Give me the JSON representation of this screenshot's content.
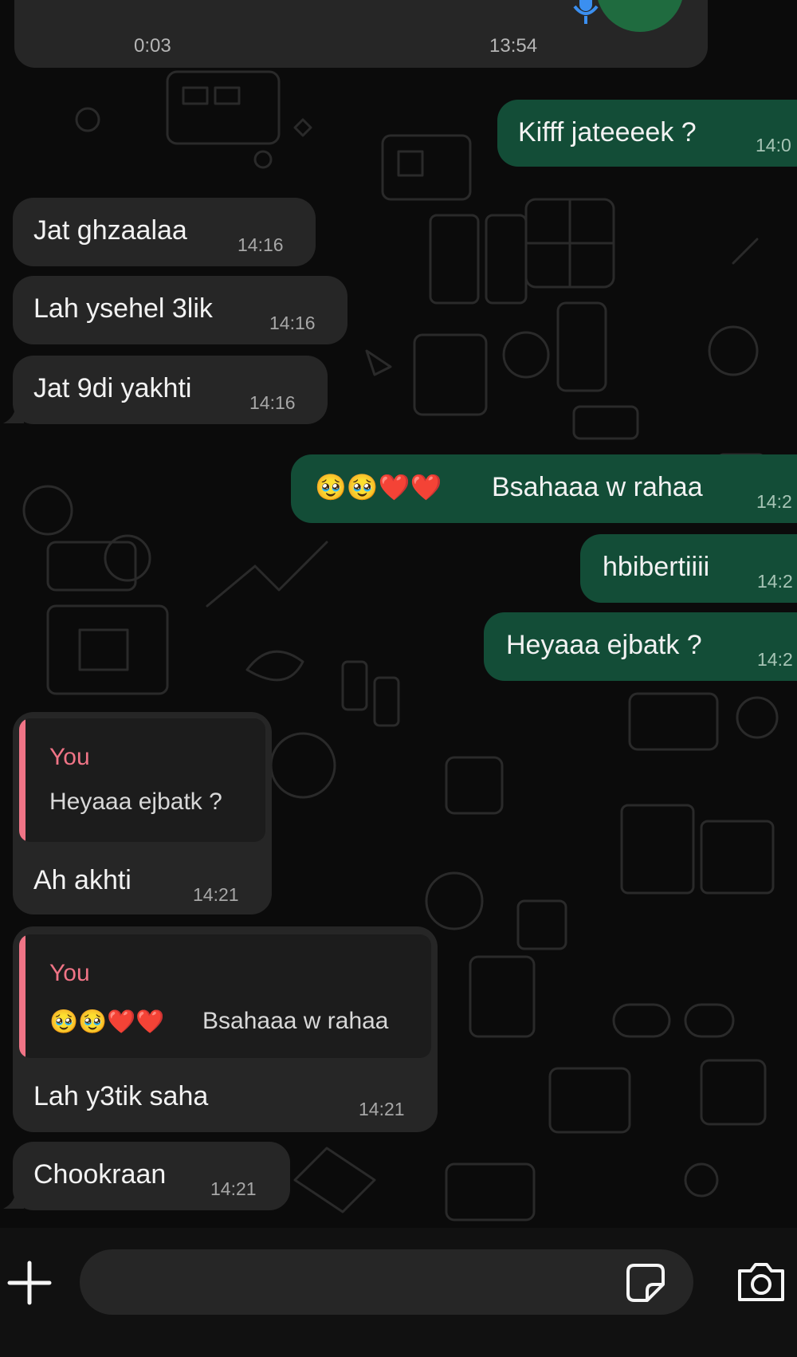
{
  "voice_message": {
    "duration": "0:03",
    "time": "13:54"
  },
  "messages": [
    {
      "dir": "out",
      "text": "Kifff jateeeek ?",
      "time": "14:0"
    },
    {
      "dir": "in",
      "text": "Jat ghzaalaa",
      "time": "14:16"
    },
    {
      "dir": "in",
      "text": "Lah ysehel 3lik",
      "time": "14:16"
    },
    {
      "dir": "in",
      "text": "Jat 9di yakhti",
      "time": "14:16"
    },
    {
      "dir": "out",
      "emojis": "🥹🥹❤️❤️",
      "text": "Bsahaaa w rahaa",
      "time": "14:2"
    },
    {
      "dir": "out",
      "text": "hbibertiiii",
      "time": "14:2"
    },
    {
      "dir": "out",
      "text": "Heyaaa ejbatk ?",
      "time": "14:2"
    },
    {
      "dir": "in",
      "quote": {
        "author": "You",
        "text": "Heyaaa ejbatk ?"
      },
      "text": "Ah akhti",
      "time": "14:21"
    },
    {
      "dir": "in",
      "quote": {
        "author": "You",
        "emojis": "🥹🥹❤️❤️",
        "text": "Bsahaaa w rahaa"
      },
      "text": "Lah y3tik saha",
      "time": "14:21"
    },
    {
      "dir": "in",
      "text": "Chookraan",
      "time": "14:21"
    }
  ],
  "composer": {
    "add_icon": "plus-icon",
    "sticker_icon": "sticker-icon",
    "camera_icon": "camera-icon",
    "mic_icon": "microphone-icon"
  },
  "colors": {
    "incoming_bubble": "#262626",
    "outgoing_bubble": "#134d37",
    "quote_accent": "#f07486",
    "background": "#0b0b0b"
  }
}
